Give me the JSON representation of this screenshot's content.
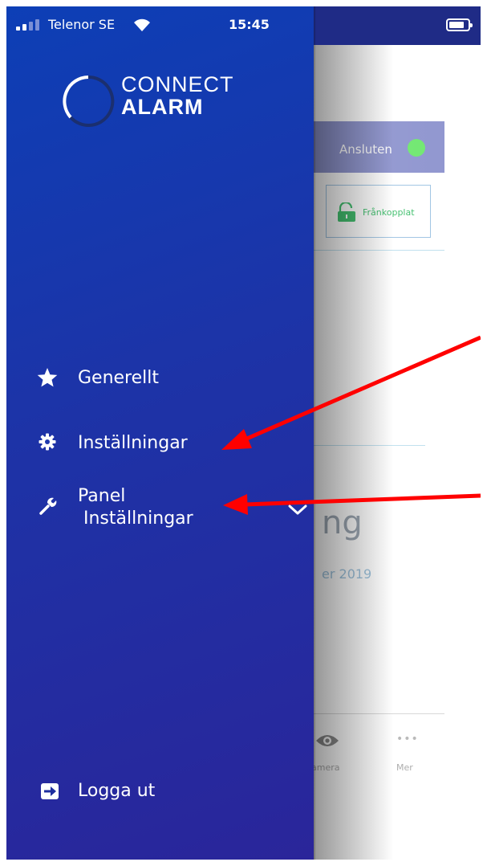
{
  "status_bar": {
    "carrier": "Telenor SE",
    "time": "15:45"
  },
  "logo": {
    "line1": "CONNECT",
    "line2": "ALARM"
  },
  "menu": {
    "items": [
      {
        "label": "Generellt",
        "icon": "star-icon"
      },
      {
        "label": "Inställningar",
        "icon": "gear-icon"
      },
      {
        "label_line1": "Panel",
        "label_line2": " Inställningar",
        "icon": "wrench-icon",
        "expand_icon": "chevron-down-icon"
      }
    ],
    "logout": {
      "label": "Logga ut",
      "icon": "logout-icon"
    }
  },
  "background_app": {
    "connection_status": "Ansluten",
    "lock_status": "Frånkopplat",
    "partial_heading": "ng",
    "partial_date": "er 2019",
    "tabs": [
      {
        "label": "amera",
        "icon": "eye-icon"
      },
      {
        "label": "Mer",
        "icon": "more-dots-icon"
      }
    ],
    "more_dots": "•••"
  },
  "colors": {
    "drawer_top": "#0d3fb6",
    "drawer_bottom": "#2a259a",
    "status_connected": "#6fe76f",
    "lock_green": "#3fbf6c",
    "annotation_arrow": "#ff0000"
  }
}
